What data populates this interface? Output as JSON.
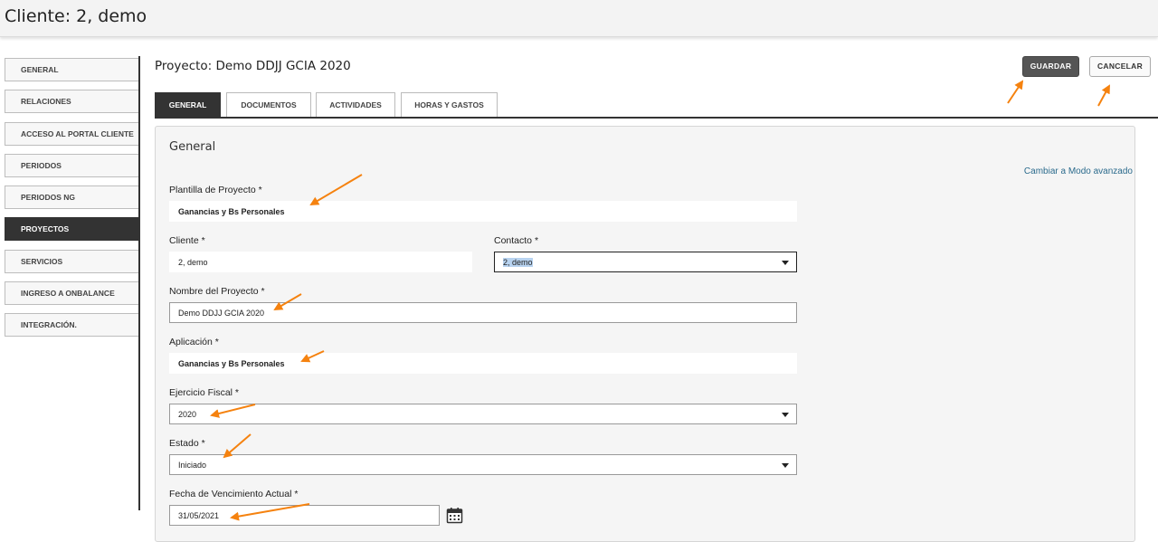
{
  "header": {
    "title": "Cliente: 2, demo"
  },
  "sidebar": {
    "items": [
      {
        "label": "GENERAL",
        "active": false
      },
      {
        "label": "RELACIONES",
        "active": false
      },
      {
        "label": "ACCESO AL PORTAL CLIENTE",
        "active": false
      },
      {
        "label": "PERIODOS",
        "active": false
      },
      {
        "label": "PERIODOS NG",
        "active": false
      },
      {
        "label": "PROYECTOS",
        "active": true
      },
      {
        "label": "SERVICIOS",
        "active": false
      },
      {
        "label": "INGRESO A ONBALANCE",
        "active": false
      },
      {
        "label": "INTEGRACIÓN.",
        "active": false
      }
    ]
  },
  "project": {
    "title": "Proyecto: Demo DDJJ GCIA 2020"
  },
  "actions": {
    "save_label": "GUARDAR",
    "cancel_label": "CANCELAR"
  },
  "tabs": [
    {
      "label": "GENERAL",
      "active": true
    },
    {
      "label": "DOCUMENTOS",
      "active": false
    },
    {
      "label": "ACTIVIDADES",
      "active": false
    },
    {
      "label": "HORAS Y GASTOS",
      "active": false
    }
  ],
  "form": {
    "section_title": "General",
    "advanced_link": "Cambiar a Modo avanzado",
    "plantilla": {
      "label": "Plantilla de Proyecto *",
      "value": "Ganancias y Bs Personales"
    },
    "cliente": {
      "label": "Cliente *",
      "value": "2, demo"
    },
    "contacto": {
      "label": "Contacto *",
      "value": "2, demo"
    },
    "nombre": {
      "label": "Nombre del Proyecto *",
      "value": "Demo DDJJ GCIA 2020"
    },
    "aplicacion": {
      "label": "Aplicación *",
      "value": "Ganancias y Bs Personales"
    },
    "ejercicio": {
      "label": "Ejercicio Fiscal *",
      "value": "2020"
    },
    "estado": {
      "label": "Estado *",
      "value": "Iniciado"
    },
    "fecha": {
      "label": "Fecha de Vencimiento Actual *",
      "value": "31/05/2021"
    }
  },
  "colors": {
    "accent_arrow": "#f5820f",
    "active_dark": "#333333",
    "link": "#2a6a8c"
  },
  "icons": {
    "calendar": "calendar-icon",
    "dropdown": "chevron-down-icon"
  }
}
